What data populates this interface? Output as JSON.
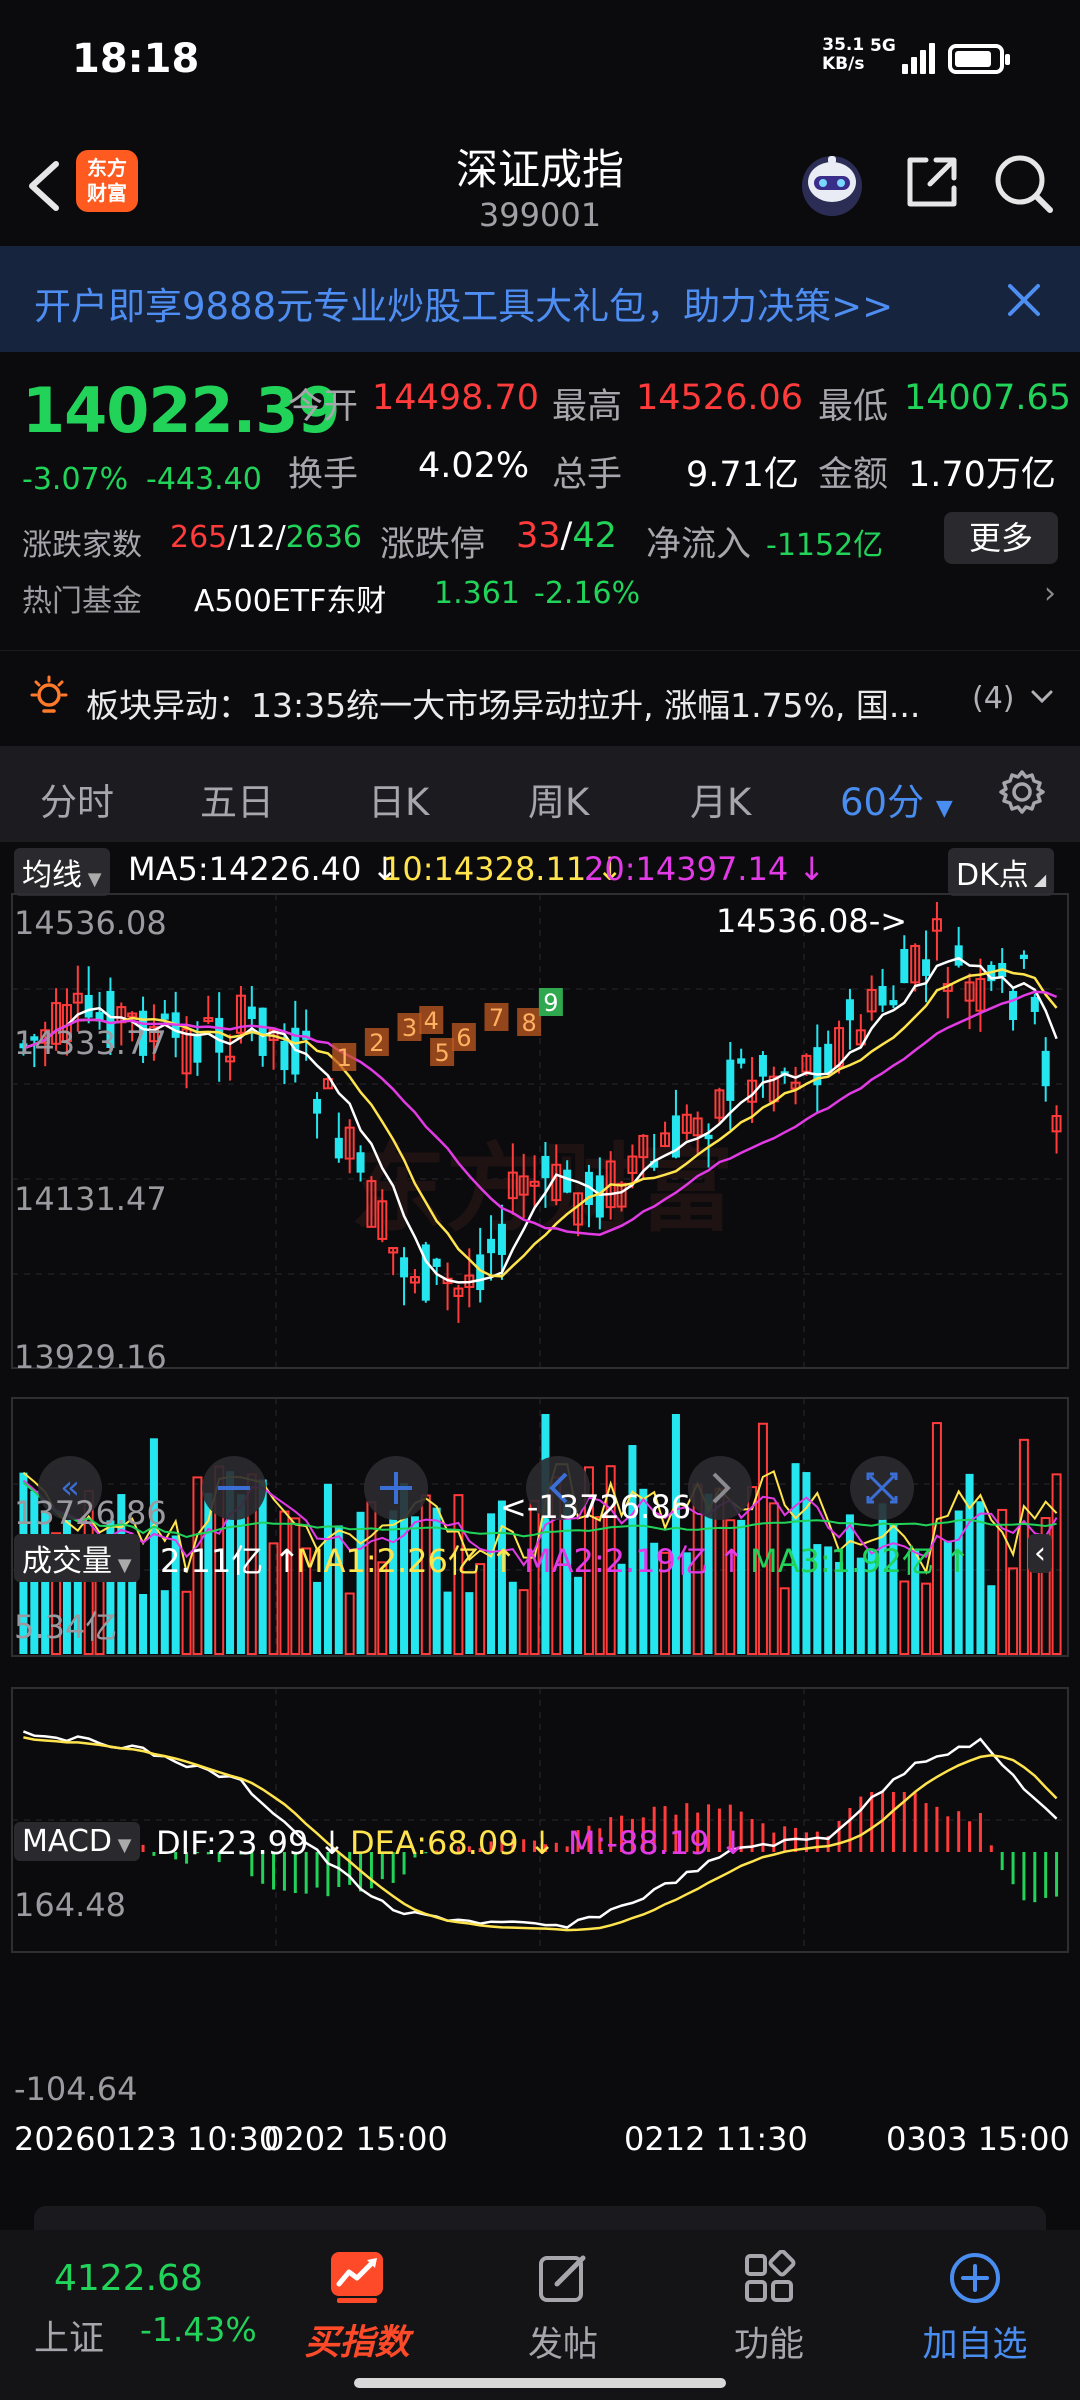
{
  "status_bar": {
    "time": "18:18",
    "net_speed": "35.1",
    "net_unit": "KB/s",
    "network": "5G"
  },
  "header": {
    "logo_line1": "东方",
    "logo_line2": "财富",
    "title": "深证成指",
    "code": "399001"
  },
  "banner": {
    "text": "开户即享9888元专业炒股工具大礼包，助力决策>>"
  },
  "quote": {
    "price": "14022.39",
    "change_pct": "-3.07%",
    "change": "-443.40",
    "open_label": "今开",
    "open": "14498.70",
    "high_label": "最高",
    "high": "14526.06",
    "low_label": "最低",
    "low": "14007.65",
    "turnover_label": "换手",
    "turnover": "4.02%",
    "volume_label": "总手",
    "volume": "9.71亿",
    "amount_label": "金额",
    "amount": "1.70万亿",
    "breadth_label": "涨跌家数",
    "breadth_up": "265",
    "breadth_flat": "12",
    "breadth_down": "2636",
    "limit_label": "涨跌停",
    "limit_up": "33",
    "limit_down": "42",
    "netflow_label": "净流入",
    "netflow": "-1152亿",
    "more": "更多",
    "fund_label": "热门基金",
    "fund_name": "A500ETF东财",
    "fund_price": "1.361",
    "fund_pct": "-2.16%"
  },
  "alert": {
    "text": "板块异动：13:35统一大市场异动拉升, 涨幅1.75%, 国...",
    "count": "(4)"
  },
  "tabs": [
    {
      "label": "分时"
    },
    {
      "label": "五日"
    },
    {
      "label": "日K"
    },
    {
      "label": "周K"
    },
    {
      "label": "月K"
    },
    {
      "label": "60分"
    }
  ],
  "main_indicators": {
    "selector": "均线",
    "ma5": "MA5:14226.40",
    "ma10": "10:14328.11",
    "ma20": "20:14397.14",
    "dk": "DK点",
    "y_top": "14536.08",
    "y_upper": "14333.77",
    "y_mid": "14131.47",
    "y_lower": "13929.16",
    "y_bottom": "13726.86",
    "high_marker": "14536.08->",
    "low_marker": "<-13726.86",
    "watermark": "东方财富"
  },
  "volume_indicators": {
    "selector": "成交量",
    "vol": "2.11亿",
    "ma1": "MA1:2.26亿",
    "ma2": "MA2:2.19亿",
    "ma3": "MA3:1.92亿",
    "y_top": "5.34亿"
  },
  "macd_indicators": {
    "selector": "MACD",
    "dif": "DIF:23.99",
    "dea": "DEA:68.09",
    "m": "M:-88.19",
    "y_top": "164.48",
    "y_bottom": "-104.64"
  },
  "x_axis": [
    "20260123 10:30",
    "0202 15:00",
    "0212 11:30",
    "0303 15:00"
  ],
  "colors": {
    "up": "#ff3b3b",
    "down": "#25e6ee",
    "ma5": "#ffffff",
    "ma10": "#ffe44d",
    "ma20": "#e23be6",
    "accent": "#4a8df0",
    "brand": "#ff5a1f"
  },
  "chart_data": {
    "type": "candlestick",
    "interval": "60分",
    "ylim": [
      13726.86,
      14536.08
    ],
    "high": 14536.08,
    "low": 13726.86,
    "volume_max": "5.34亿",
    "macd_range": [
      -104.64,
      164.48
    ],
    "td_counts_visible": [
      "1",
      "2",
      "3",
      "4",
      "5",
      "6",
      "7",
      "8",
      "9"
    ]
  },
  "bottom_nav": {
    "sh_price": "4122.68",
    "sh_label": "上证",
    "sh_pct": "-1.43%",
    "items": [
      {
        "label": "买指数",
        "icon": "trend-chart-icon"
      },
      {
        "label": "发帖",
        "icon": "edit-icon"
      },
      {
        "label": "功能",
        "icon": "grid-icon"
      },
      {
        "label": "加自选",
        "icon": "add-circle-icon"
      }
    ]
  }
}
